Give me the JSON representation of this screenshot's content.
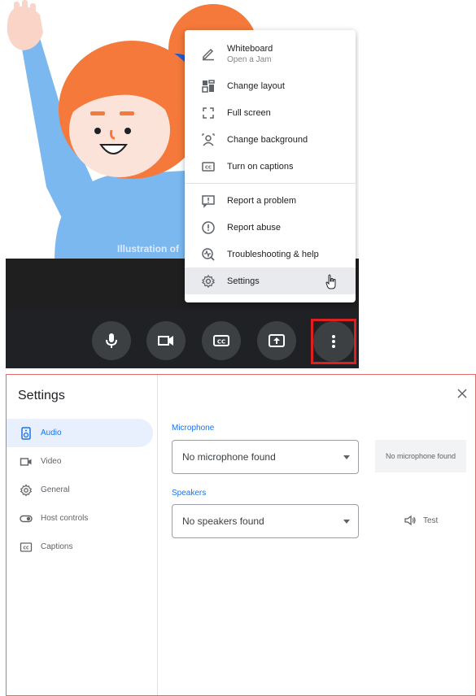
{
  "illustration": {
    "caption": "Illustration of"
  },
  "menu": {
    "items": [
      {
        "label": "Whiteboard",
        "sublabel": "Open a Jam",
        "icon": "pencil-icon"
      },
      {
        "label": "Change layout",
        "icon": "layout-icon"
      },
      {
        "label": "Full screen",
        "icon": "fullscreen-icon"
      },
      {
        "label": "Change background",
        "icon": "background-icon"
      },
      {
        "label": "Turn on captions",
        "icon": "captions-icon"
      },
      {
        "label": "Report a problem",
        "icon": "report-problem-icon"
      },
      {
        "label": "Report abuse",
        "icon": "report-abuse-icon"
      },
      {
        "label": "Troubleshooting & help",
        "icon": "troubleshoot-icon"
      },
      {
        "label": "Settings",
        "icon": "gear-icon"
      }
    ]
  },
  "toolbar": {
    "buttons": [
      "microphone-icon",
      "camera-icon",
      "captions-icon",
      "present-icon",
      "more-options-icon"
    ]
  },
  "settings": {
    "title": "Settings",
    "nav": [
      {
        "label": "Audio",
        "icon": "speaker-icon",
        "active": true
      },
      {
        "label": "Video",
        "icon": "video-icon",
        "active": false
      },
      {
        "label": "General",
        "icon": "gear-icon",
        "active": false
      },
      {
        "label": "Host controls",
        "icon": "toggle-icon",
        "active": false
      },
      {
        "label": "Captions",
        "icon": "captions-icon",
        "active": false
      }
    ],
    "microphone": {
      "label": "Microphone",
      "value": "No microphone found",
      "status": "No microphone found"
    },
    "speakers": {
      "label": "Speakers",
      "value": "No speakers found",
      "test_label": "Test"
    }
  },
  "colors": {
    "accent": "#1a73e8",
    "highlight": "#e02020",
    "toolbar": "#202124"
  }
}
